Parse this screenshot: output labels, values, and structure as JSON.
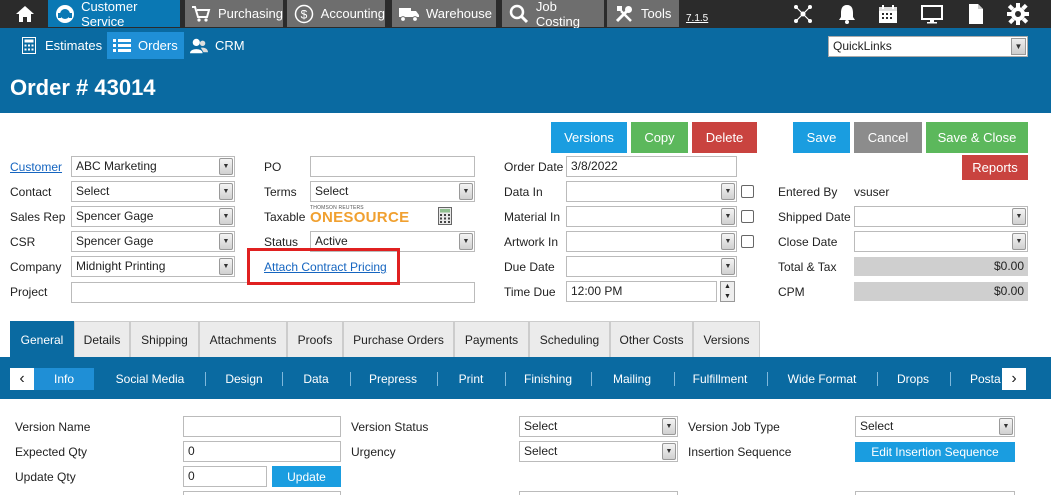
{
  "topbar": {
    "items": [
      {
        "label": "Customer Service",
        "icon": "headset-icon"
      },
      {
        "label": "Purchasing",
        "icon": "cart-icon"
      },
      {
        "label": "Accounting",
        "icon": "dollar-icon"
      },
      {
        "label": "Warehouse",
        "icon": "truck-icon"
      },
      {
        "label": "Job Costing",
        "icon": "search-icon"
      },
      {
        "label": "Tools",
        "icon": "tools-icon"
      }
    ],
    "version": "7.1.5"
  },
  "subbar": {
    "items": [
      {
        "label": "Estimates",
        "icon": "calculator-icon"
      },
      {
        "label": "Orders",
        "icon": "list-icon"
      },
      {
        "label": "CRM",
        "icon": "users-icon"
      }
    ],
    "quicklinks": "QuickLinks"
  },
  "page": {
    "title": "Order # 43014"
  },
  "actions": {
    "versions": "Versions",
    "copy": "Copy",
    "delete": "Delete",
    "save": "Save",
    "cancel": "Cancel",
    "save_close": "Save & Close",
    "reports": "Reports"
  },
  "form": {
    "customer_label": "Customer",
    "customer_value": "ABC Marketing",
    "contact_label": "Contact",
    "contact_value": "Select",
    "salesrep_label": "Sales Rep",
    "salesrep_value": "Spencer Gage",
    "csr_label": "CSR",
    "csr_value": "Spencer Gage",
    "company_label": "Company",
    "company_value": "Midnight Printing",
    "project_label": "Project",
    "project_value": "",
    "po_label": "PO",
    "po_value": "",
    "terms_label": "Terms",
    "terms_value": "Select",
    "taxable_label": "Taxable",
    "taxable_brand_top": "THOMSON REUTERS",
    "taxable_brand": "ONESOURCE",
    "status_label": "Status",
    "status_value": "Active",
    "attach_contract": "Attach Contract Pricing",
    "orderdate_label": "Order Date",
    "orderdate_value": "3/8/2022",
    "datain_label": "Data In",
    "materialin_label": "Material In",
    "artworkin_label": "Artwork In",
    "duedate_label": "Due Date",
    "timedue_label": "Time Due",
    "timedue_value": "12:00 PM",
    "enteredby_label": "Entered By",
    "enteredby_value": "vsuser",
    "shippeddate_label": "Shipped Date",
    "closedate_label": "Close Date",
    "totaltax_label": "Total & Tax",
    "totaltax_value": "$0.00",
    "cpm_label": "CPM",
    "cpm_value": "$0.00"
  },
  "tabs": [
    "General",
    "Details",
    "Shipping",
    "Attachments",
    "Proofs",
    "Purchase Orders",
    "Payments",
    "Scheduling",
    "Other Costs",
    "Versions"
  ],
  "subtabs": [
    "Info",
    "Social Media",
    "Design",
    "Data",
    "Prepress",
    "Print",
    "Finishing",
    "Mailing",
    "Fulfillment",
    "Wide Format",
    "Drops",
    "Posta"
  ],
  "info": {
    "version_name_label": "Version Name",
    "version_name_value": "",
    "expected_qty_label": "Expected Qty",
    "expected_qty_value": "0",
    "update_qty_label": "Update Qty",
    "update_qty_value": "0",
    "update_button": "Update",
    "version_status_label": "Version Status",
    "version_status_value": "Select",
    "urgency_label": "Urgency",
    "urgency_value": "Select",
    "version_job_type_label": "Version Job Type",
    "version_job_type_value": "Select",
    "insertion_seq_label": "Insertion Sequence",
    "insertion_seq_button": "Edit Insertion Sequence"
  }
}
